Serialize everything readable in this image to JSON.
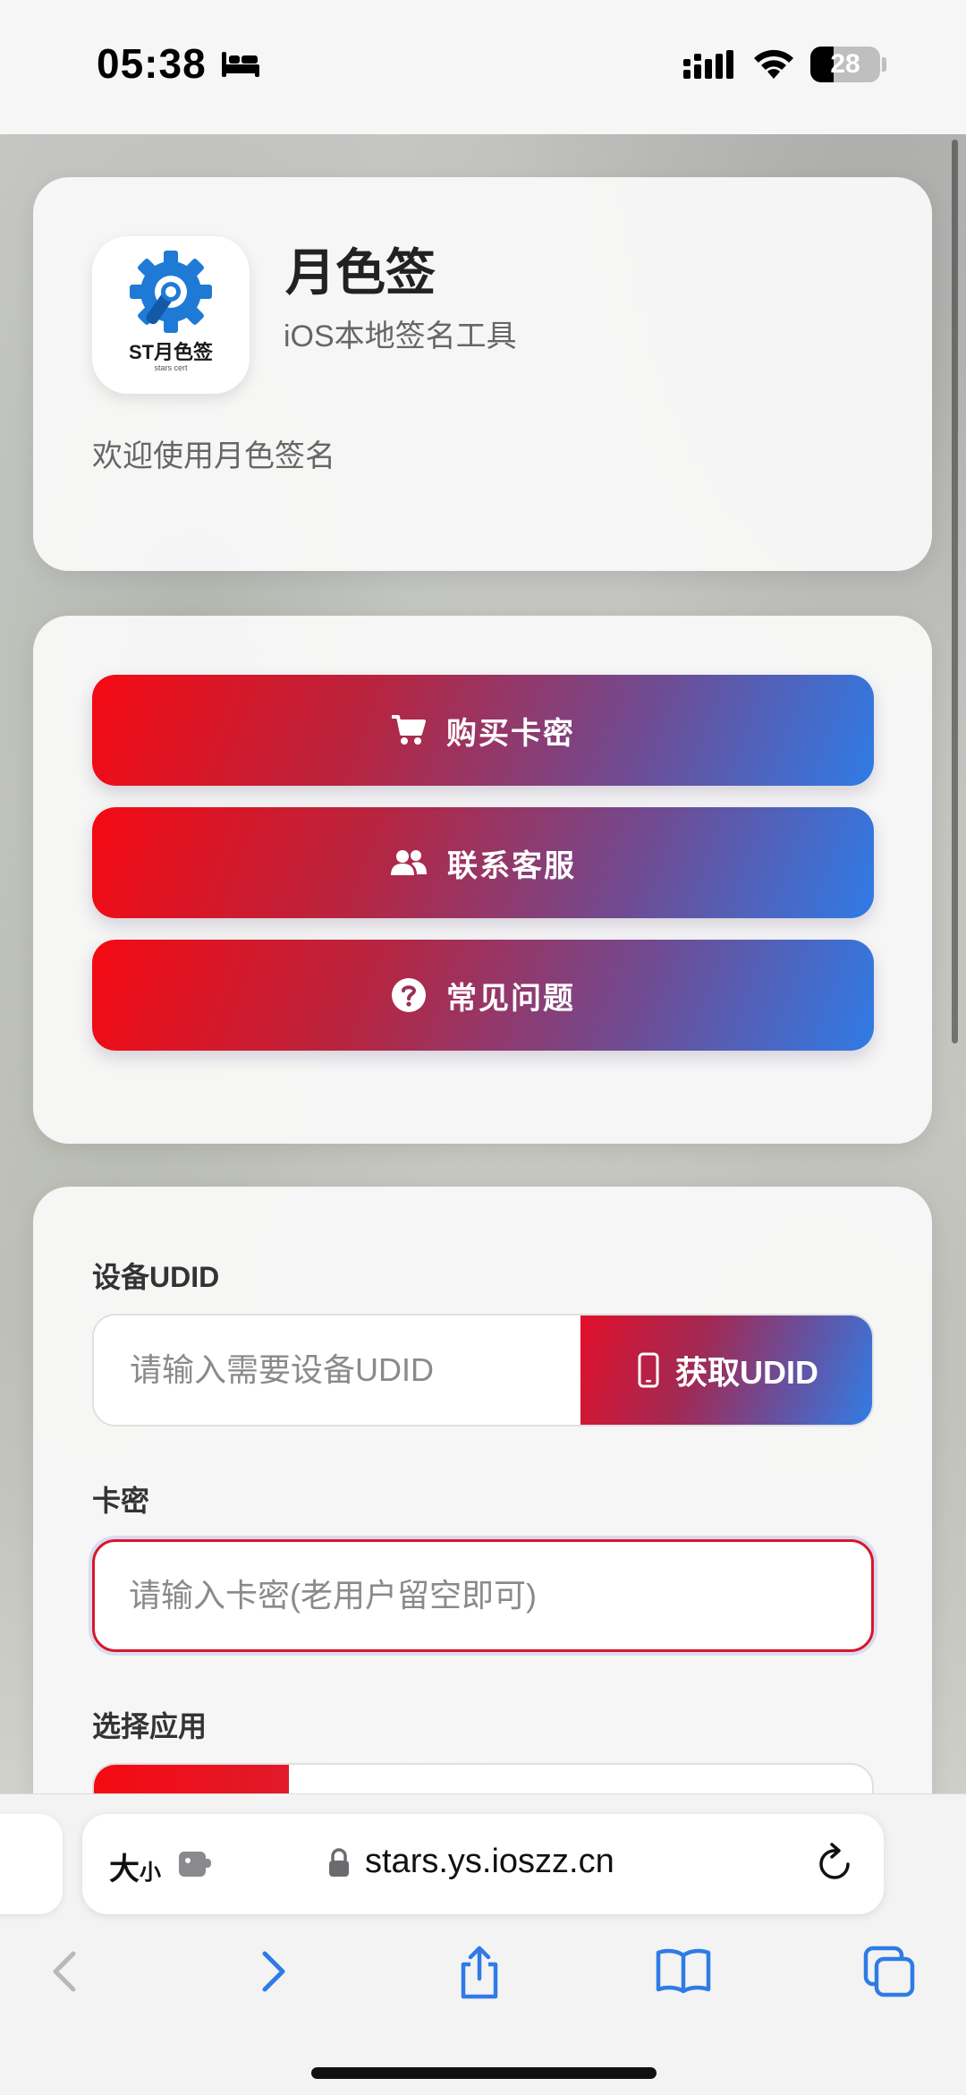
{
  "status_bar": {
    "time": "05:38",
    "battery_level": "28",
    "icons": [
      "bed-icon",
      "signal-icon",
      "wifi-icon",
      "battery-icon"
    ]
  },
  "header": {
    "app_name": "月色签",
    "subtitle": "iOS本地签名工具",
    "welcome": "欢迎使用月色签名",
    "logo_text": "ST月色签",
    "logo_subtext": "stars cert"
  },
  "actions": [
    {
      "label": "购买卡密",
      "icon": "cart-icon"
    },
    {
      "label": "联系客服",
      "icon": "users-icon"
    },
    {
      "label": "常见问题",
      "icon": "question-circle-icon"
    }
  ],
  "form": {
    "udid_label": "设备UDID",
    "udid_placeholder": "请输入需要设备UDID",
    "udid_value": "",
    "udid_button": "获取UDID",
    "card_label": "卡密",
    "card_placeholder": "请输入卡密(老用户留空即可)",
    "card_value": "",
    "app_label": "选择应用"
  },
  "browser": {
    "aa_main": "大",
    "aa_small": "小",
    "url": "stars.ys.ioszz.cn",
    "nav_icons": [
      "back-icon",
      "forward-icon",
      "share-icon",
      "bookmarks-icon",
      "tabs-icon"
    ]
  },
  "colors": {
    "gradient_start": "#f50a12",
    "gradient_end": "#2f7be6",
    "focus_border": "#d8162a",
    "ios_blue": "#2f7be6"
  }
}
